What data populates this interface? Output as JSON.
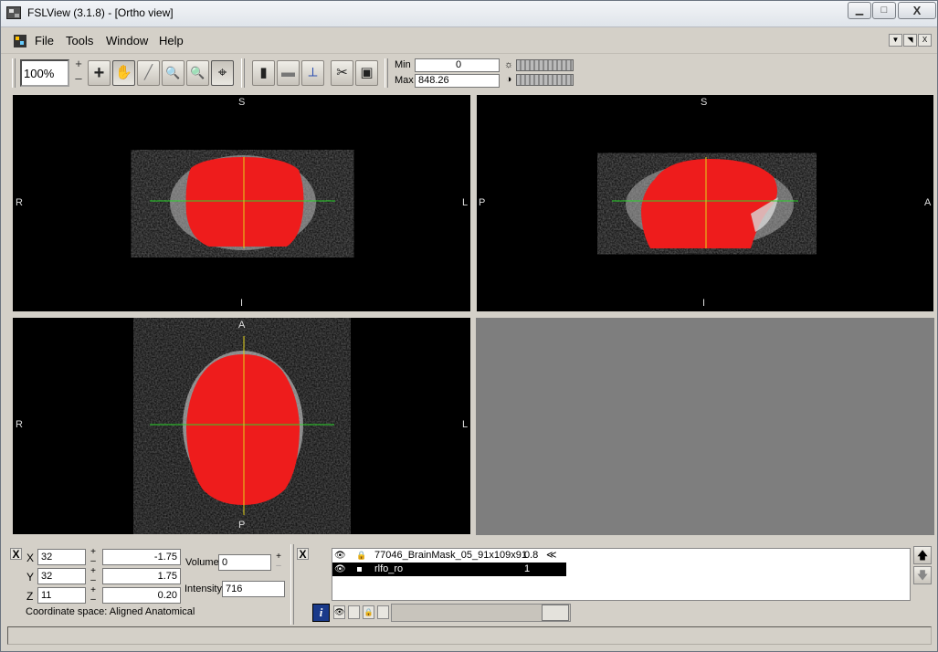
{
  "window": {
    "title": "FSLView (3.1.8) - [Ortho view]",
    "min_glyph": "▁",
    "max_glyph": "□",
    "close_glyph": "X"
  },
  "menu": {
    "file": "File",
    "tools": "Tools",
    "window": "Window",
    "help": "Help",
    "mdi_min": "▼",
    "mdi_restore": "◥",
    "mdi_close": "X"
  },
  "toolbar": {
    "zoom": "100%",
    "zoom_plus": "+",
    "zoom_minus": "–",
    "min_label": "Min",
    "min_value": "0",
    "max_label": "Max",
    "max_value": "848.26",
    "icons": {
      "cursor": "+",
      "pan": "✋",
      "pencil": "╱",
      "zoom": "🔍",
      "zoom_region": "🔍",
      "crosshair": "⌖",
      "single_view": "▮",
      "lightbox": "▬",
      "axis": "⟂",
      "scissors": "✂",
      "camera": "▣",
      "brightness": "☼",
      "contrast": "◑"
    }
  },
  "views": {
    "coronal": {
      "top": "S",
      "bottom": "I",
      "left": "R",
      "right": "L"
    },
    "sagittal": {
      "top": "S",
      "bottom": "I",
      "left": "P",
      "right": "A"
    },
    "axial": {
      "top": "A",
      "bottom": "P",
      "left": "R",
      "right": "L"
    }
  },
  "colors": {
    "overlay": "#ee1c1c",
    "crosshair_h": "#2ad52a",
    "crosshair_v": "#e2d21a",
    "background": "#000000",
    "empty": "#7e7e7e"
  },
  "cursor_panel": {
    "close": "X",
    "x_label": "X",
    "x_voxel": "32",
    "x_mm": "-1.75",
    "y_label": "Y",
    "y_voxel": "32",
    "y_mm": "1.75",
    "z_label": "Z",
    "z_voxel": "11",
    "z_mm": "0.20",
    "plus": "+",
    "minus": "–",
    "volume_label": "Volume",
    "volume_value": "0",
    "intensity_label": "Intensity",
    "intensity_value": "716",
    "coord_space": "Coordinate space: Aligned Anatomical"
  },
  "layers": {
    "close": "X",
    "rows": [
      {
        "name": "77046_BrainMask_05_91x109x91",
        "opacity": "0.8",
        "extra": "≪"
      },
      {
        "name": "rlfo_ro",
        "opacity": "1"
      }
    ],
    "up": "🡅",
    "down": "🡇",
    "info": "i",
    "eye": "👁",
    "lock": "🔒"
  }
}
